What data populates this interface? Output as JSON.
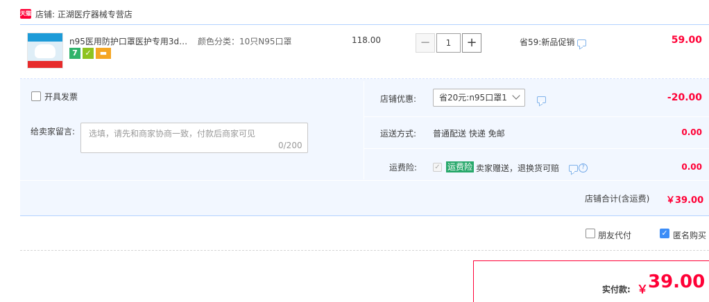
{
  "header": {
    "tmall_badge": "天猫",
    "shop_label": "店铺: 正湖医疗器械专营店"
  },
  "item": {
    "title": "n95医用防护口罩医护专用3d立...",
    "spec": "颜色分类：10只N95口罩",
    "unit_price": "118.00",
    "quantity": "1",
    "minus_label": "−",
    "plus_label": "+",
    "promo": "省59:新品促销",
    "subtotal": "59.00",
    "badges": [
      "7",
      "✓",
      "▬"
    ]
  },
  "options": {
    "invoice_label": "开具发票",
    "message_label": "给卖家留言:",
    "message_placeholder": "选填，请先和商家协商一致，付款后商家可见",
    "message_count": "0/200",
    "coupon_label": "店铺优惠:",
    "coupon_value": "省20元:n95口罩1",
    "discount": "-20.00",
    "shipping_label": "运送方式:",
    "shipping_value": "普通配送 快递 免邮",
    "shipping_fee": "0.00",
    "insurance_label": "运费险:",
    "insurance_tag": "运费险",
    "insurance_text": "卖家赠送，退换货可赔",
    "insurance_fee": "0.00",
    "shop_total_label": "店铺合计(含运费)",
    "shop_total_value": "￥39.00"
  },
  "footer": {
    "friend_pay_label": "朋友代付",
    "anonymous_label": "匿名购买",
    "pay_label": "实付款:",
    "pay_currency": "￥",
    "pay_amount": "39.00"
  },
  "colors": {
    "accent": "#ff0036",
    "section_bg": "#f2f7ff",
    "border_blue": "#b2d1ff"
  }
}
